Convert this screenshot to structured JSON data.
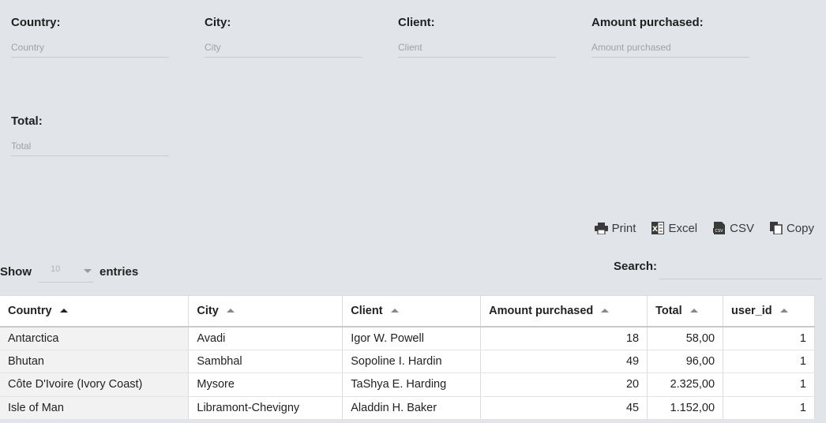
{
  "filters": [
    {
      "label": "Country:",
      "placeholder": "Country"
    },
    {
      "label": "City:",
      "placeholder": "City"
    },
    {
      "label": "Client:",
      "placeholder": "Client"
    },
    {
      "label": "Amount purchased:",
      "placeholder": "Amount purchased"
    },
    {
      "label": "Total:",
      "placeholder": "Total"
    }
  ],
  "buttons": {
    "print": "Print",
    "excel": "Excel",
    "csv": "CSV",
    "copy": "Copy"
  },
  "length": {
    "show_label": "Show",
    "value": "10",
    "entries_label": "entries"
  },
  "search": {
    "label": "Search:"
  },
  "table": {
    "columns": [
      "Country",
      "City",
      "Client",
      "Amount purchased",
      "Total",
      "user_id"
    ],
    "sorted_column": "Country",
    "rows": [
      [
        "Antarctica",
        "Avadi",
        "Igor W. Powell",
        "18",
        "58,00",
        "1"
      ],
      [
        "Bhutan",
        "Sambhal",
        "Sopoline I. Hardin",
        "49",
        "96,00",
        "1"
      ],
      [
        "Côte D'Ivoire (Ivory Coast)",
        "Mysore",
        "TaShya E. Harding",
        "20",
        "2.325,00",
        "1"
      ],
      [
        "Isle of Man",
        "Libramont-Chevigny",
        "Aladdin H. Baker",
        "45",
        "1.152,00",
        "1"
      ]
    ]
  }
}
